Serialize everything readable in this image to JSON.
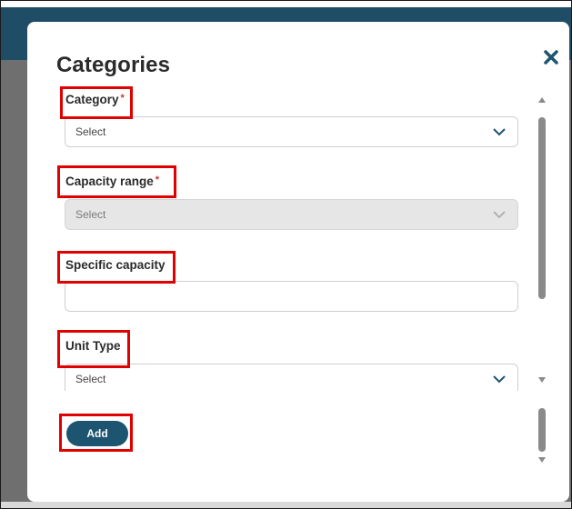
{
  "modal": {
    "title": "Categories",
    "close_icon": "close-x-icon"
  },
  "fields": {
    "category": {
      "label": "Category",
      "required_mark": "*",
      "value": "Select"
    },
    "capacity_range": {
      "label": "Capacity range",
      "required_mark": "*",
      "value": "Select",
      "disabled": true
    },
    "specific_capacity": {
      "label": "Specific capacity",
      "value": ""
    },
    "unit_type": {
      "label": "Unit Type",
      "value": "Select"
    }
  },
  "actions": {
    "add_label": "Add"
  },
  "colors": {
    "primary": "#1d5470",
    "required": "#c0392b",
    "highlight": "#e00000",
    "header": "#1f4d66"
  }
}
